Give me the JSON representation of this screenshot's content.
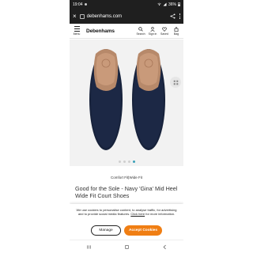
{
  "status_bar": {
    "time": "19:04",
    "battery": "36%"
  },
  "browser": {
    "url": "debenhams.com"
  },
  "site_header": {
    "menu_label": "Menu",
    "brand": "Debenhams",
    "icons": [
      {
        "icon": "search-icon",
        "label": "Search"
      },
      {
        "icon": "person-icon",
        "label": "Sign in"
      },
      {
        "icon": "heart-icon",
        "label": "Saved"
      },
      {
        "icon": "bag-icon",
        "label": "Bag"
      }
    ]
  },
  "product": {
    "image_subject": "Navy court shoes, top view",
    "carousel": {
      "count": 4,
      "active_index": 3
    },
    "brand_line": "Comfort Fit|Wide Fit",
    "title": "Good for the Sole - Navy 'Gina' Mid Heel Wide Fit Court Shoes"
  },
  "cookie_banner": {
    "text_before_link": "We use cookies to personalise content, to analyse traffic, for advertising and to provide social media features.",
    "link_text": "Click here",
    "text_after_link": "for more information.",
    "manage_label": "Manage",
    "accept_label": "Accept Cookies"
  },
  "colors": {
    "accent_orange": "#f07e13",
    "status_bar_bg": "#1f1f1f",
    "shoe_navy": "#17223b",
    "carousel_active": "#3aa0b8"
  }
}
